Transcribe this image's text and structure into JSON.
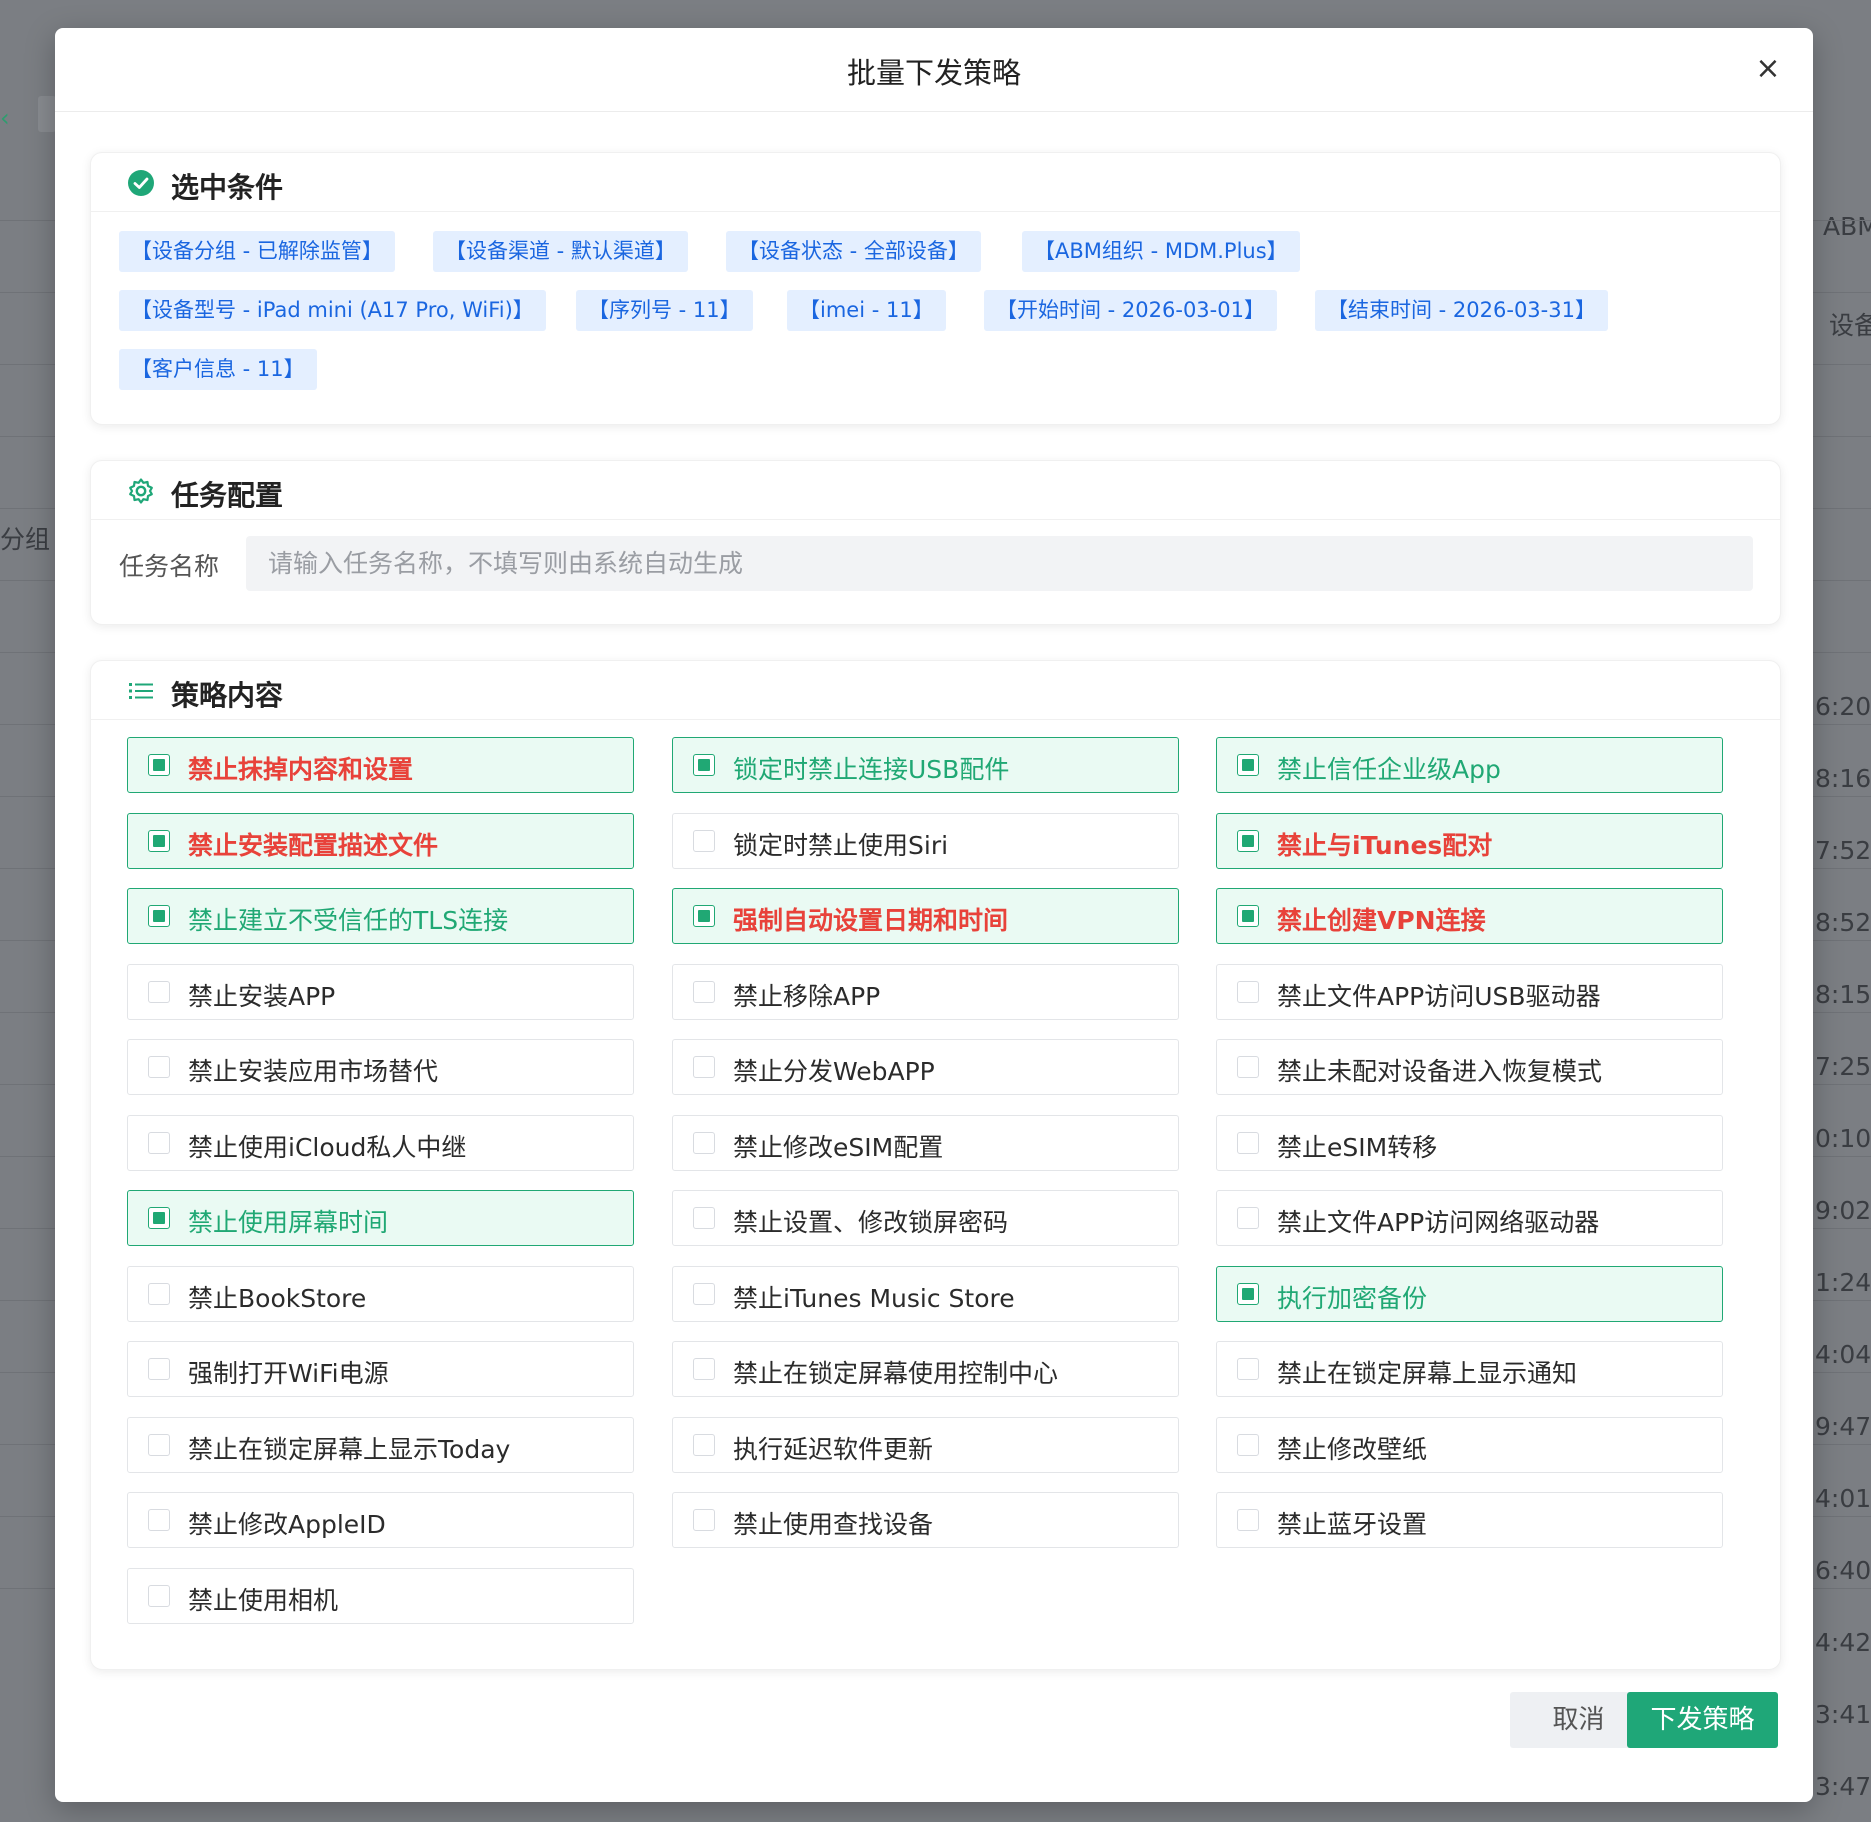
{
  "background": {
    "right_texts": [
      "ABM",
      "设备",
      "6:20",
      "8:16",
      "7:52",
      "8:52",
      "8:15",
      "7:25",
      "0:10",
      "9:02",
      "1:24",
      "4:04",
      "9:47",
      "4:01",
      "6:40",
      "4:42",
      "3:41",
      "3:47"
    ],
    "left_text": "分组"
  },
  "modal": {
    "title": "批量下发策略",
    "close_icon": "×"
  },
  "conditions": {
    "title": "选中条件",
    "tags": [
      "【设备分组 - 已解除监管】",
      "【设备渠道 - 默认渠道】",
      "【设备状态 - 全部设备】",
      "【ABM组织 - MDM.Plus】",
      "【设备型号 - iPad mini (A17 Pro, WiFi)】",
      "【序列号 - 11】",
      "【imei - 11】",
      "【开始时间 - 2026-03-01】",
      "【结束时间 - 2026-03-31】",
      "【客户信息 - 11】"
    ]
  },
  "task": {
    "title": "任务配置",
    "name_label": "任务名称",
    "name_value": "",
    "name_placeholder": "请输入任务名称，不填写则由系统自动生成"
  },
  "policy": {
    "title": "策略内容",
    "items": [
      {
        "label": "禁止抹掉内容和设置",
        "checked": true,
        "danger": true
      },
      {
        "label": "锁定时禁止连接USB配件",
        "checked": true,
        "danger": false
      },
      {
        "label": "禁止信任企业级App",
        "checked": true,
        "danger": false
      },
      {
        "label": "禁止安装配置描述文件",
        "checked": true,
        "danger": true
      },
      {
        "label": "锁定时禁止使用Siri",
        "checked": false,
        "danger": false
      },
      {
        "label": "禁止与iTunes配对",
        "checked": true,
        "danger": true
      },
      {
        "label": "禁止建立不受信任的TLS连接",
        "checked": true,
        "danger": false
      },
      {
        "label": "强制自动设置日期和时间",
        "checked": true,
        "danger": true
      },
      {
        "label": "禁止创建VPN连接",
        "checked": true,
        "danger": true
      },
      {
        "label": "禁止安装APP",
        "checked": false,
        "danger": false
      },
      {
        "label": "禁止移除APP",
        "checked": false,
        "danger": false
      },
      {
        "label": "禁止文件APP访问USB驱动器",
        "checked": false,
        "danger": false
      },
      {
        "label": "禁止安装应用市场替代",
        "checked": false,
        "danger": false
      },
      {
        "label": "禁止分发WebAPP",
        "checked": false,
        "danger": false
      },
      {
        "label": "禁止未配对设备进入恢复模式",
        "checked": false,
        "danger": false
      },
      {
        "label": "禁止使用iCloud私人中继",
        "checked": false,
        "danger": false
      },
      {
        "label": "禁止修改eSIM配置",
        "checked": false,
        "danger": false
      },
      {
        "label": "禁止eSIM转移",
        "checked": false,
        "danger": false
      },
      {
        "label": "禁止使用屏幕时间",
        "checked": true,
        "danger": false
      },
      {
        "label": "禁止设置、修改锁屏密码",
        "checked": false,
        "danger": false
      },
      {
        "label": "禁止文件APP访问网络驱动器",
        "checked": false,
        "danger": false
      },
      {
        "label": "禁止BookStore",
        "checked": false,
        "danger": false
      },
      {
        "label": "禁止iTunes Music Store",
        "checked": false,
        "danger": false
      },
      {
        "label": "执行加密备份",
        "checked": true,
        "danger": false
      },
      {
        "label": "强制打开WiFi电源",
        "checked": false,
        "danger": false
      },
      {
        "label": "禁止在锁定屏幕使用控制中心",
        "checked": false,
        "danger": false
      },
      {
        "label": "禁止在锁定屏幕上显示通知",
        "checked": false,
        "danger": false
      },
      {
        "label": "禁止在锁定屏幕上显示Today",
        "checked": false,
        "danger": false
      },
      {
        "label": "执行延迟软件更新",
        "checked": false,
        "danger": false
      },
      {
        "label": "禁止修改壁纸",
        "checked": false,
        "danger": false
      },
      {
        "label": "禁止修改AppleID",
        "checked": false,
        "danger": false
      },
      {
        "label": "禁止使用查找设备",
        "checked": false,
        "danger": false
      },
      {
        "label": "禁止蓝牙设置",
        "checked": false,
        "danger": false
      },
      {
        "label": "禁止使用相机",
        "checked": false,
        "danger": false
      }
    ]
  },
  "footer": {
    "cancel_label": "取消",
    "submit_label": "下发策略"
  },
  "colors": {
    "accent": "#1fa778",
    "danger": "#e8423a",
    "tag_bg": "#e4efff",
    "tag_text": "#1a66e0"
  }
}
